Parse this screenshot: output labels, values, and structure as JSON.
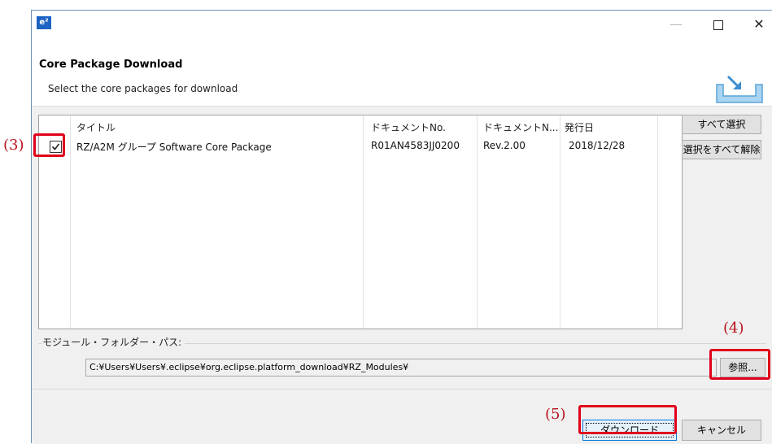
{
  "window": {
    "app_icon": "e²",
    "controls": {
      "minimize": "—",
      "maximize": "",
      "close": "✕"
    }
  },
  "header": {
    "title": "Core Package Download",
    "subtitle": "Select the core packages for download",
    "icon": "download-tray-icon"
  },
  "table": {
    "columns": [
      "タイトル",
      "ドキュメントNo.",
      "ドキュメントN...",
      "発行日"
    ],
    "rows": [
      {
        "checked": true,
        "title": "RZ/A2M グループ Software Core Package",
        "doc_no": "R01AN4583JJ0200",
        "doc_rev": "Rev.2.00",
        "date": "2018/12/28"
      }
    ]
  },
  "side_buttons": {
    "select_all": "すべて選択",
    "deselect_all": "選択をすべて解除"
  },
  "module_folder": {
    "label": "モジュール・フォルダー・パス:",
    "path": "C:¥Users¥Users¥.eclipse¥org.eclipse.platform_download¥RZ_Modules¥",
    "browse_label": "参照..."
  },
  "footer": {
    "download_label": "ダウンロード",
    "cancel_label": "キャンセル"
  },
  "annotations": {
    "a3": "(3)",
    "a4": "(4)",
    "a5": "(5)",
    "color": "#e0001a"
  }
}
